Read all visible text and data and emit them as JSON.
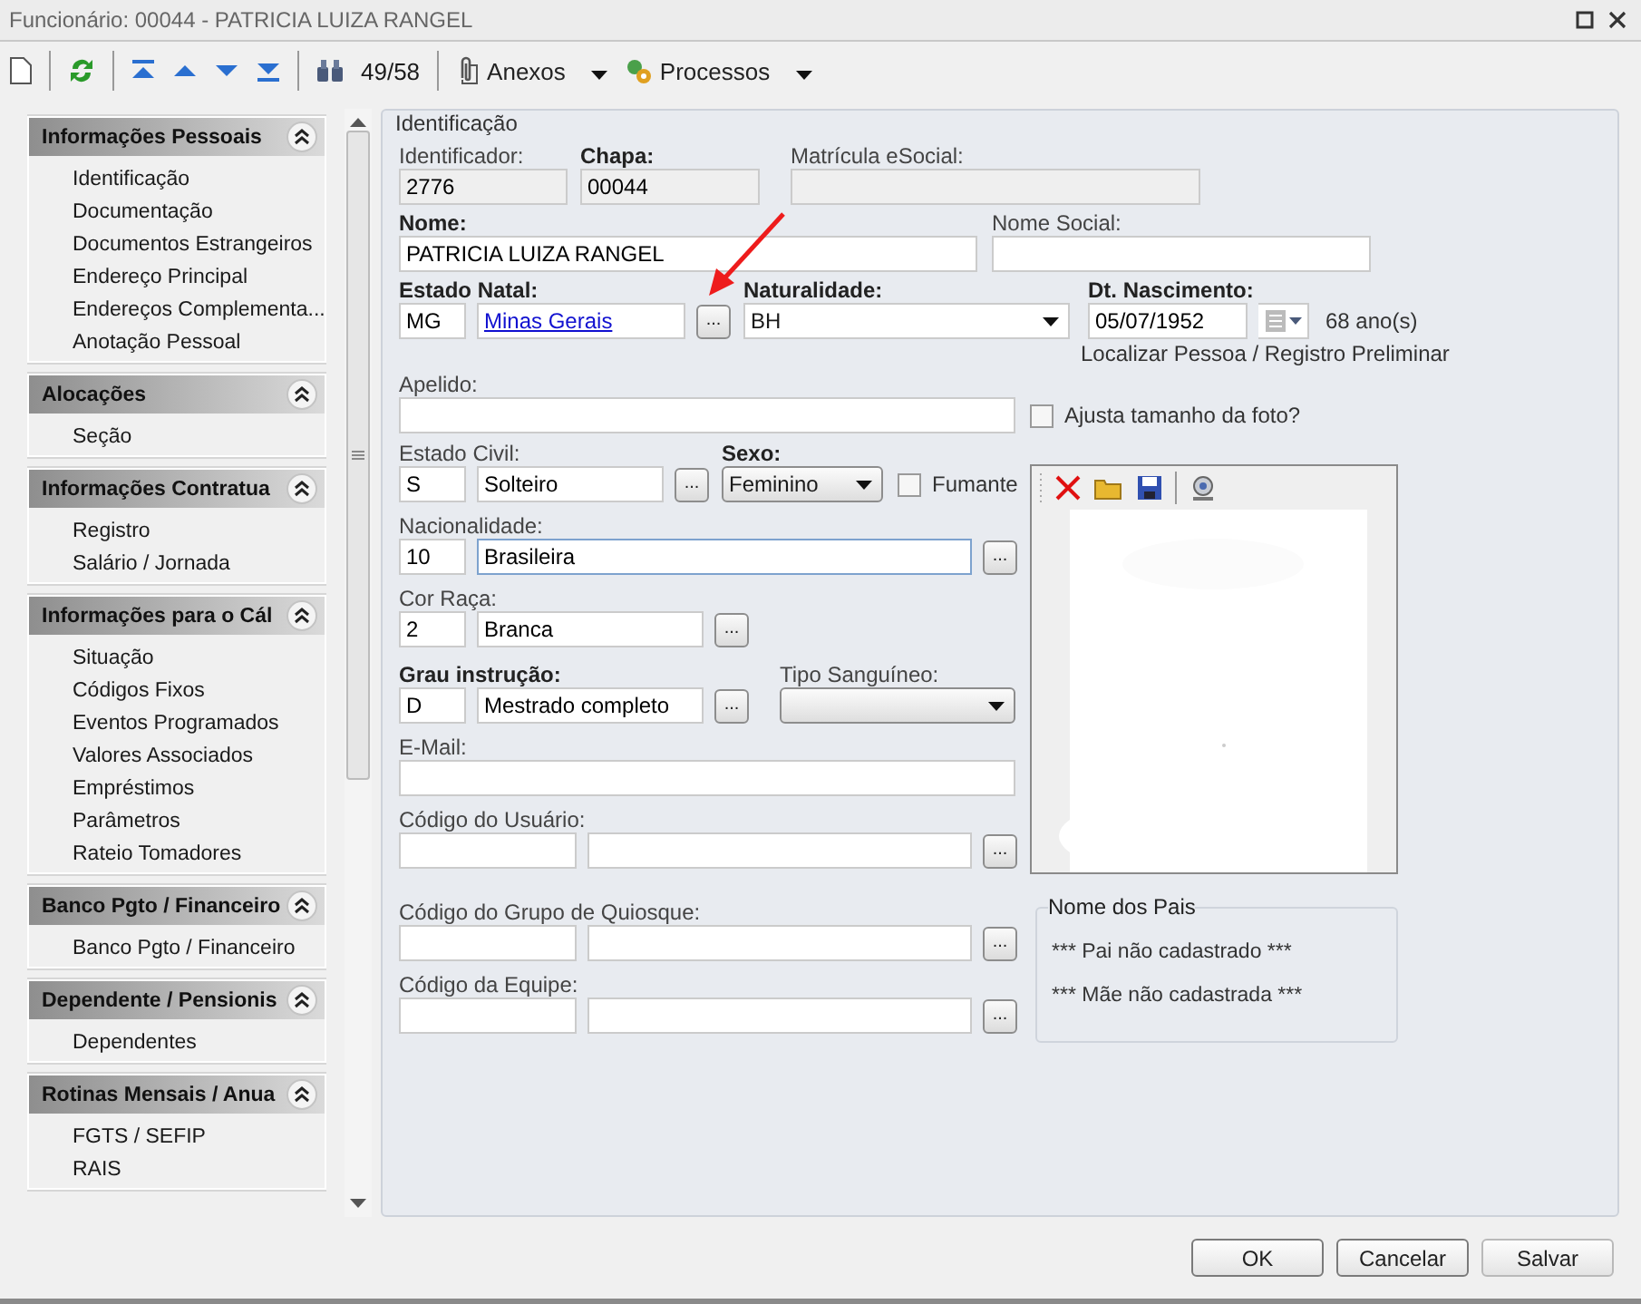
{
  "window": {
    "title": "Funcionário: 00044 - PATRICIA LUIZA RANGEL"
  },
  "toolbar": {
    "record_counter": "49/58",
    "menus": [
      {
        "label": "Anexos"
      },
      {
        "label": "Processos"
      }
    ]
  },
  "sidebar": {
    "groups": [
      {
        "title": "Informações Pessoais",
        "expanded": true,
        "items": [
          "Identificação",
          "Documentação",
          "Documentos Estrangeiros",
          "Endereço Principal",
          "Endereços Complementa...",
          "Anotação Pessoal"
        ]
      },
      {
        "title": "Alocações",
        "expanded": true,
        "items": [
          "Seção"
        ]
      },
      {
        "title": "Informações Contratua",
        "expanded": true,
        "items": [
          "Registro",
          "Salário / Jornada"
        ]
      },
      {
        "title": "Informações para o Cál",
        "expanded": true,
        "items": [
          "Situação",
          "Códigos Fixos",
          "Eventos Programados",
          "Valores Associados",
          "Empréstimos",
          "Parâmetros",
          "Rateio Tomadores"
        ]
      },
      {
        "title": "Banco Pgto / Financeiro",
        "expanded": true,
        "items": [
          "Banco Pgto / Financeiro"
        ]
      },
      {
        "title": "Dependente / Pensionis",
        "expanded": true,
        "items": [
          "Dependentes"
        ]
      },
      {
        "title": "Rotinas Mensais / Anua",
        "expanded": true,
        "items": [
          "FGTS / SEFIP",
          "RAIS"
        ]
      }
    ]
  },
  "form": {
    "section": "Identificação",
    "identificador": {
      "label": "Identificador:",
      "value": "2776",
      "required": false
    },
    "chapa": {
      "label": "Chapa:",
      "value": "00044",
      "required": true
    },
    "matricula_esocial": {
      "label": "Matrícula eSocial:",
      "required": false
    },
    "nome": {
      "label": "Nome:",
      "value": "PATRICIA LUIZA RANGEL",
      "required": true
    },
    "nome_social": {
      "label": "Nome Social:",
      "required": false
    },
    "estado_natal": {
      "label": "Estado Natal:",
      "code": "MG",
      "description": "Minas Gerais",
      "link": true,
      "required": true,
      "button": "..."
    },
    "naturalidade": {
      "label": "Naturalidade:",
      "value": "BH",
      "required": true
    },
    "dt_nascimento": {
      "label": "Dt. Nascimento:",
      "value": "05/07/1952",
      "age": "68 ano(s)",
      "required": true
    },
    "localizar": "Localizar Pessoa / Registro Preliminar",
    "apelido": {
      "label": "Apelido:",
      "required": false
    },
    "ajusta_foto": {
      "label": "Ajusta tamanho da foto?",
      "checked": false
    },
    "estado_civil": {
      "label": "Estado Civil:",
      "code": "S",
      "description": "Solteiro",
      "required": false,
      "button": "..."
    },
    "sexo": {
      "label": "Sexo:",
      "value": "Feminino",
      "required": true
    },
    "fumante": {
      "label": "Fumante",
      "checked": false
    },
    "nacionalidade": {
      "label": "Nacionalidade:",
      "code": "10",
      "description": "Brasileira",
      "focused": true,
      "required": false,
      "button": "..."
    },
    "cor_raca": {
      "label": "Cor Raça:",
      "code": "2",
      "description": "Branca",
      "required": false,
      "button": "..."
    },
    "grau_instrucao": {
      "label": "Grau instrução:",
      "code": "D",
      "description": "Mestrado completo",
      "required": true,
      "button": "..."
    },
    "tipo_sanguineo": {
      "label": "Tipo Sanguíneo:",
      "required": false
    },
    "email": {
      "label": "E-Mail:",
      "required": false
    },
    "codigo_usuario": {
      "label": "Código do Usuário:",
      "required": false,
      "button": "..."
    },
    "grupo_quiosque": {
      "label": "Código do Grupo de Quiosque:",
      "required": false,
      "button": "..."
    },
    "equipe": {
      "label": "Código da Equipe:",
      "required": false,
      "button": "..."
    },
    "nome_dos_pais": {
      "title": "Nome dos Pais",
      "pai": "*** Pai não cadastrado ***",
      "mae": "*** Mãe não cadastrada ***"
    }
  },
  "buttons": [
    {
      "label": "OK"
    },
    {
      "label": "Cancelar"
    },
    {
      "label": "Salvar"
    }
  ]
}
